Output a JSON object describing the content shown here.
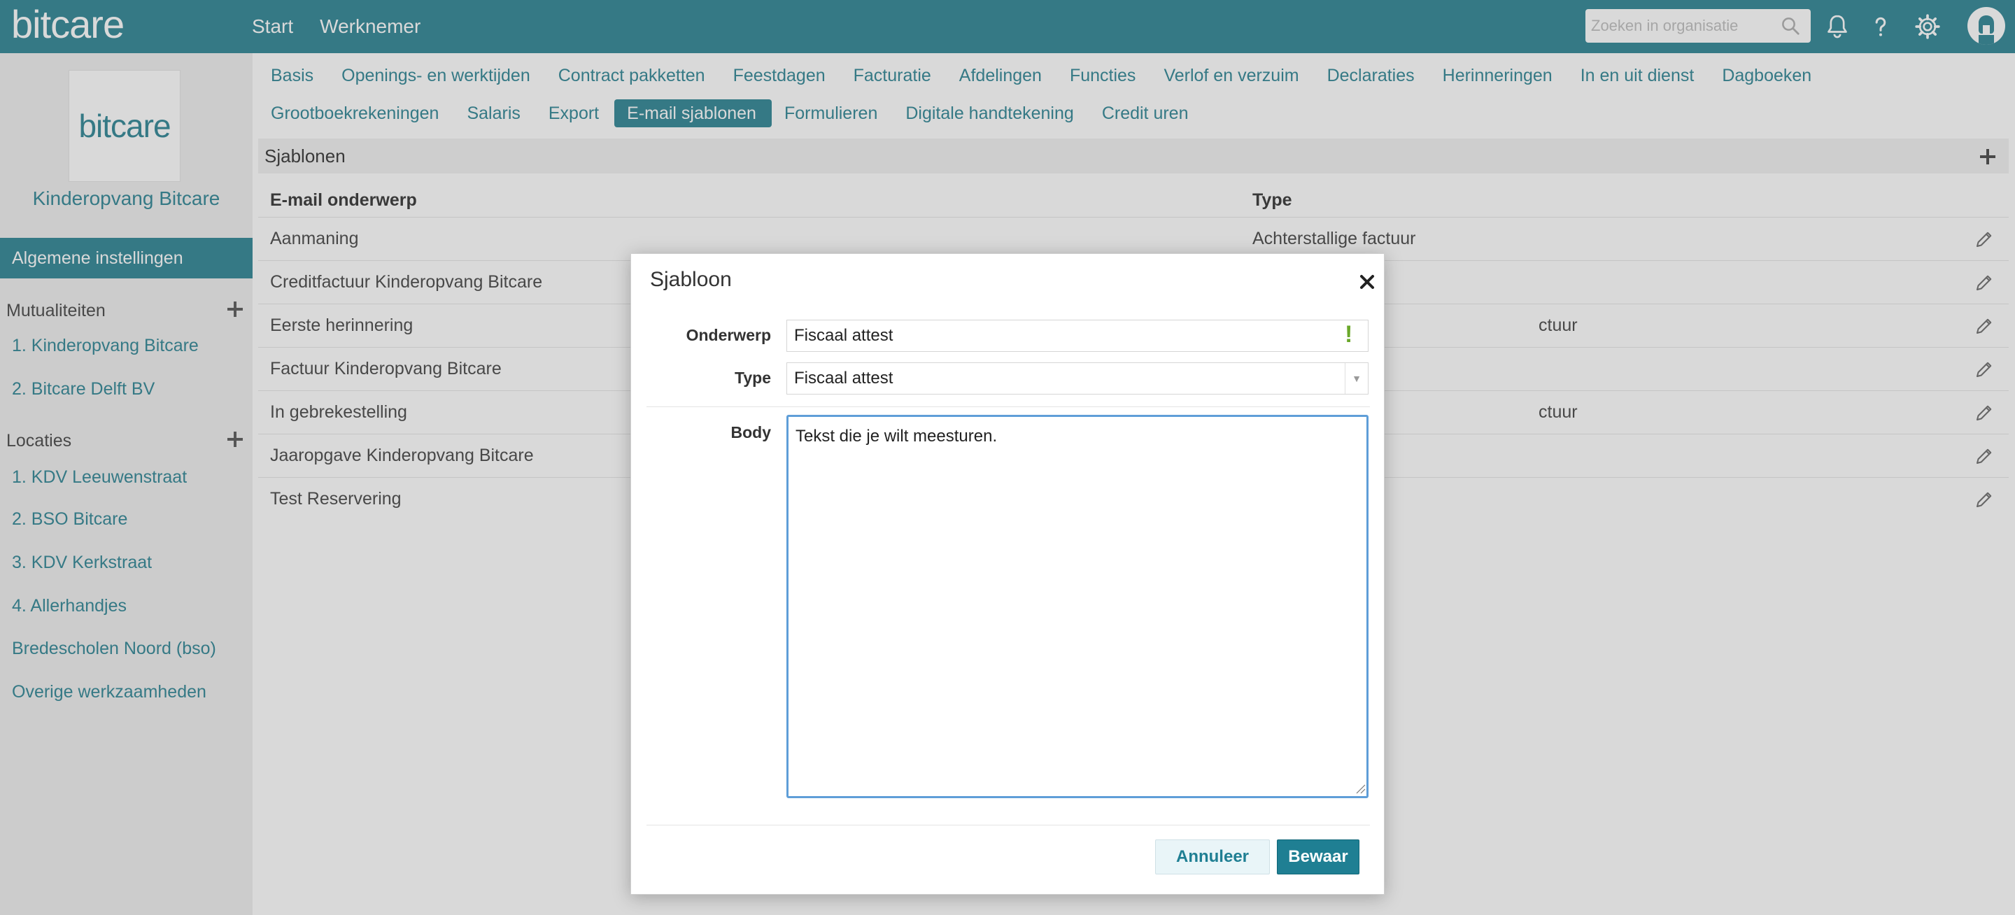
{
  "header": {
    "logo": "bitcare",
    "nav": [
      "Start",
      "Werknemer"
    ],
    "search_placeholder": "Zoeken in organisatie"
  },
  "sidebar": {
    "logo": "bitcare",
    "org_name": "Kinderopvang Bitcare",
    "active_item": "Algemene instellingen",
    "mutualities": {
      "title": "Mutualiteiten",
      "items": [
        "1. Kinderopvang Bitcare",
        "2. Bitcare Delft BV"
      ]
    },
    "locations": {
      "title": "Locaties",
      "items": [
        "1. KDV Leeuwenstraat",
        "2. BSO Bitcare",
        "3. KDV Kerkstraat",
        "4. Allerhandjes",
        "Bredescholen Noord (bso)",
        "Overige werkzaamheden"
      ]
    }
  },
  "tabs": {
    "row1": [
      "Basis",
      "Openings- en werktijden",
      "Contract pakketten",
      "Feestdagen",
      "Facturatie",
      "Afdelingen",
      "Functies",
      "Verlof en verzuim",
      "Declaraties",
      "Herinneringen",
      "In en uit dienst",
      "Dagboeken"
    ],
    "row2": [
      "Grootboekrekeningen",
      "Salaris",
      "Export",
      "E-mail sjablonen",
      "Formulieren",
      "Digitale handtekening",
      "Credit uren"
    ],
    "active": "E-mail sjablonen"
  },
  "templates": {
    "title": "Sjablonen",
    "columns": [
      "E-mail onderwerp",
      "Type"
    ],
    "rows": [
      {
        "subject": "Aanmaning",
        "type": "Achterstallige factuur"
      },
      {
        "subject": "Creditfactuur Kinderopvang Bitcare",
        "type": ""
      },
      {
        "subject": "Eerste herinnering",
        "type": "ctuur"
      },
      {
        "subject": "Factuur Kinderopvang Bitcare",
        "type": ""
      },
      {
        "subject": "In gebrekestelling",
        "type": "ctuur"
      },
      {
        "subject": "Jaaropgave Kinderopvang Bitcare",
        "type": ""
      },
      {
        "subject": "Test Reservering",
        "type": ""
      }
    ]
  },
  "modal": {
    "title": "Sjabloon",
    "subject_label": "Onderwerp",
    "subject_value": "Fiscaal attest",
    "type_label": "Type",
    "type_value": "Fiscaal attest",
    "body_label": "Body",
    "body_value": "Tekst die je wilt meesturen.",
    "cancel_label": "Annuleer",
    "save_label": "Bewaar"
  },
  "colors": {
    "brand": "#3f8f9d",
    "primary_button": "#1f7f93",
    "warning": "#6aa82a",
    "focus": "#5f9ed8"
  }
}
